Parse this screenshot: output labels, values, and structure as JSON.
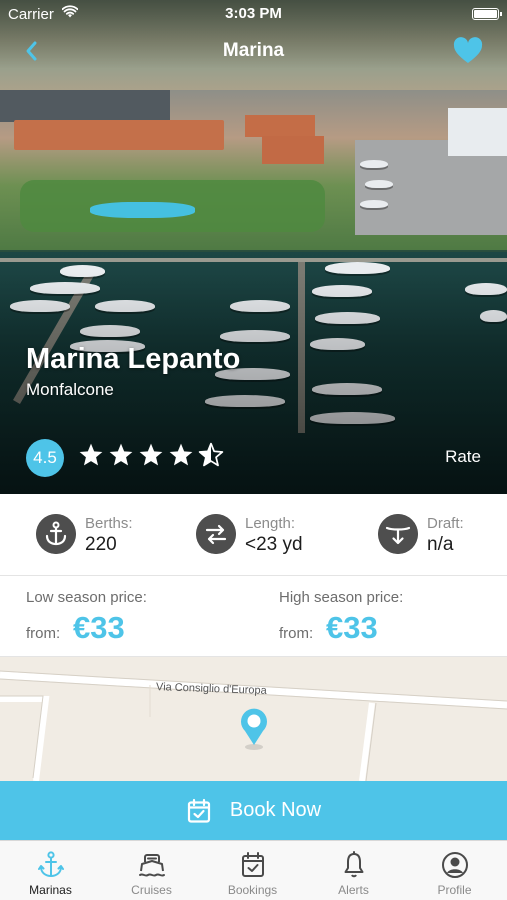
{
  "status_bar": {
    "carrier": "Carrier",
    "time": "3:03 PM"
  },
  "nav": {
    "title": "Marina",
    "back_icon": "chevron-left-icon",
    "favorite_icon": "heart-icon"
  },
  "marina": {
    "name": "Marina Lepanto",
    "city": "Monfalcone",
    "rating": "4.5",
    "stars": 4.5,
    "rate_label": "Rate"
  },
  "specs": [
    {
      "label": "Berths:",
      "value": "220",
      "icon": "anchor-icon"
    },
    {
      "label": "Length:",
      "value": "<23 yd",
      "icon": "length-arrows-icon"
    },
    {
      "label": "Draft:",
      "value": "n/a",
      "icon": "draft-icon"
    }
  ],
  "prices": {
    "low": {
      "label": "Low season price:",
      "from": "from:",
      "value": "€33"
    },
    "high": {
      "label": "High season price:",
      "from": "from:",
      "value": "€33"
    }
  },
  "map": {
    "street": "Via Consiglio d'Europa",
    "pin_icon": "location-pin-icon"
  },
  "book": {
    "label": "Book Now",
    "icon": "calendar-check-icon"
  },
  "tabs": [
    {
      "label": "Marinas",
      "icon": "anchor-icon",
      "active": true
    },
    {
      "label": "Cruises",
      "icon": "ship-icon",
      "active": false
    },
    {
      "label": "Bookings",
      "icon": "calendar-check-icon",
      "active": false
    },
    {
      "label": "Alerts",
      "icon": "bell-icon",
      "active": false
    },
    {
      "label": "Profile",
      "icon": "user-circle-icon",
      "active": false
    }
  ],
  "colors": {
    "accent": "#4ec4e8",
    "tab_active": "#4ec4e8",
    "icon_dark": "#4e4e4e"
  }
}
